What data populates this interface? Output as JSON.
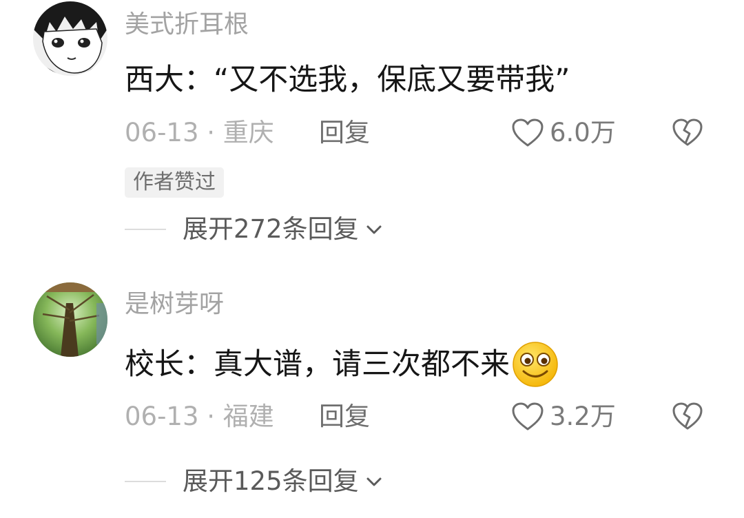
{
  "comments": [
    {
      "username": "美式折耳根",
      "content": "西大：“又不选我，保底又要带我”",
      "date_location": "06-13 · 重庆",
      "reply_label": "回复",
      "like_count": "6.0万",
      "badge": "作者赞过",
      "expand_label": "展开272条回复",
      "avatar_icon": "anime-boy-avatar",
      "has_emoji": false
    },
    {
      "username": "是树芽呀",
      "content": "校长：真大谱，请三次都不来",
      "date_location": "06-13 · 福建",
      "reply_label": "回复",
      "like_count": "3.2万",
      "badge": "",
      "expand_label": "展开125条回复",
      "avatar_icon": "tree-photo-avatar",
      "has_emoji": true,
      "emoji_icon": "smiling-face-emoji"
    }
  ],
  "colors": {
    "username": "#a3a3a3",
    "content": "#161616",
    "meta": "#b0b0b0",
    "icon": "#6e6e6e",
    "badge_bg": "#f1f1f1"
  }
}
